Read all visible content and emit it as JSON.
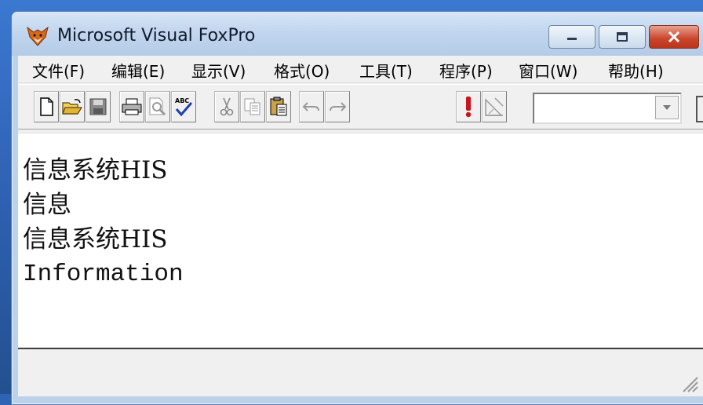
{
  "window": {
    "title": "Microsoft Visual FoxPro",
    "app_icon": "foxpro-fox-head-icon"
  },
  "menubar": {
    "items": [
      {
        "label": "文件(F)"
      },
      {
        "label": "编辑(E)"
      },
      {
        "label": "显示(V)"
      },
      {
        "label": "格式(O)"
      },
      {
        "label": "工具(T)"
      },
      {
        "label": "程序(P)"
      },
      {
        "label": "窗口(W)"
      },
      {
        "label": "帮助(H)"
      }
    ]
  },
  "toolbar": {
    "buttons": [
      "new-icon",
      "open-icon",
      "save-icon",
      "print-icon",
      "print-preview-icon",
      "spelling-icon",
      "cut-icon",
      "copy-icon",
      "paste-icon",
      "undo-icon",
      "redo-icon",
      "run-icon",
      "form-wizard-icon"
    ],
    "combo_value": ""
  },
  "output": {
    "lines": [
      "信息系统HIS",
      "信息",
      "信息系统HIS",
      "Information"
    ]
  },
  "colors": {
    "close_button": "#c9442a",
    "titlebar": "#c2d6ee",
    "desktop": "#2f63b4"
  }
}
